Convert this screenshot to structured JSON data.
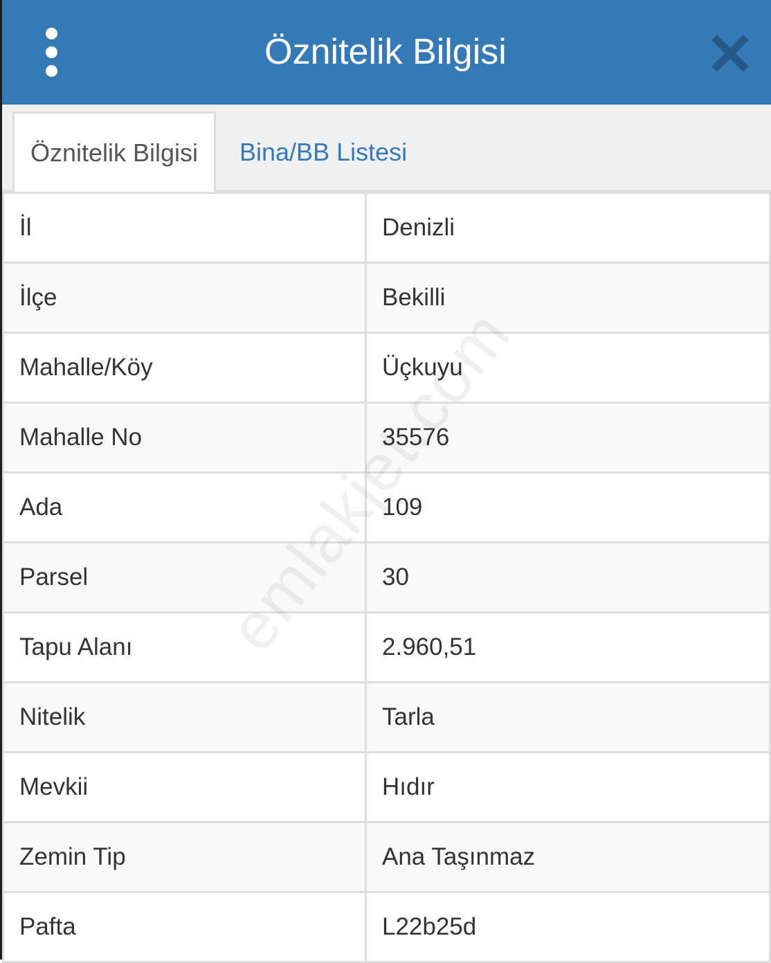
{
  "header": {
    "title": "Öznitelik Bilgisi",
    "menu_icon": "vertical-ellipsis-icon",
    "close_icon": "close-icon",
    "background_color": "#337ab7"
  },
  "tabs": [
    {
      "label": "Öznitelik Bilgisi",
      "active": true
    },
    {
      "label": "Bina/BB Listesi",
      "active": false
    }
  ],
  "attributes": [
    {
      "key": "İl",
      "value": "Denizli"
    },
    {
      "key": "İlçe",
      "value": "Bekilli"
    },
    {
      "key": "Mahalle/Köy",
      "value": "Üçkuyu"
    },
    {
      "key": "Mahalle No",
      "value": "35576"
    },
    {
      "key": "Ada",
      "value": "109"
    },
    {
      "key": "Parsel",
      "value": "30"
    },
    {
      "key": "Tapu Alanı",
      "value": "2.960,51"
    },
    {
      "key": "Nitelik",
      "value": "Tarla"
    },
    {
      "key": "Mevkii",
      "value": "Hıdır"
    },
    {
      "key": "Zemin Tip",
      "value": "Ana Taşınmaz"
    },
    {
      "key": "Pafta",
      "value": "L22b25d"
    }
  ],
  "watermark": "emlakjet.com"
}
